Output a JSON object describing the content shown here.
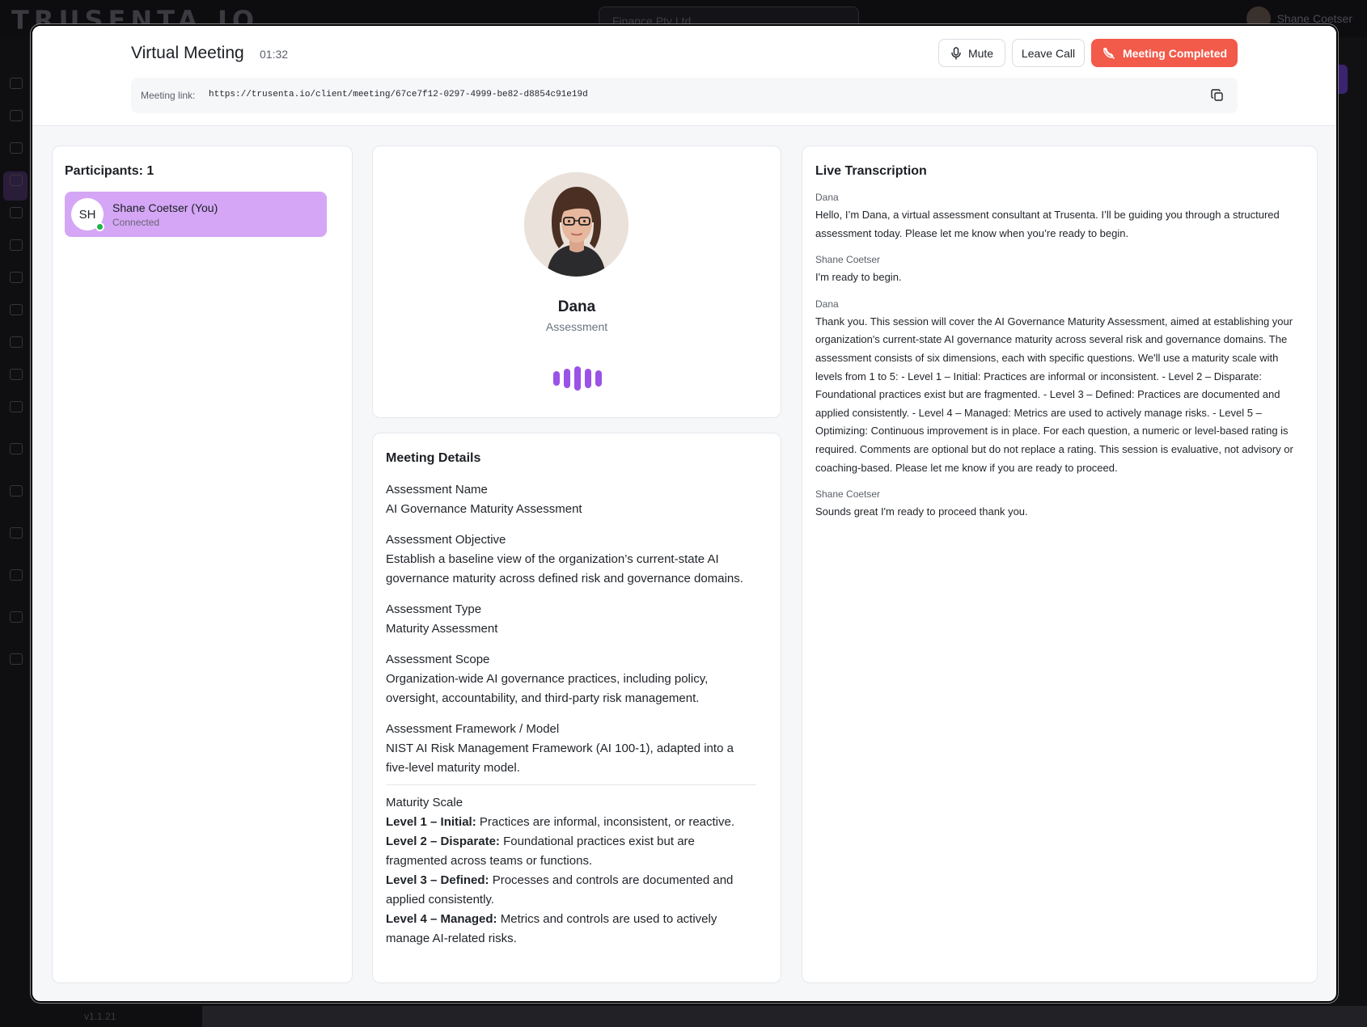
{
  "background": {
    "logo": "TRUSENTA.IO",
    "org_selector": "Finance Pty Ltd",
    "user_name": "Shane Coetser",
    "version": "v1.1.21"
  },
  "meeting": {
    "title": "Virtual Meeting",
    "timer": "01:32",
    "mute_label": "Mute",
    "leave_label": "Leave Call",
    "complete_label": "Meeting Completed",
    "link_label": "Meeting link:",
    "link_url": "https://trusenta.io/client/meeting/67ce7f12-0297-4999-be82-d8854c91e19d"
  },
  "participants": {
    "title": "Participants: 1",
    "items": [
      {
        "initials": "SH",
        "name": "Shane Coetser (You)",
        "status": "Connected"
      }
    ]
  },
  "agent": {
    "name": "Dana",
    "role": "Assessment"
  },
  "details": {
    "title": "Meeting Details",
    "fields": [
      {
        "label": "Assessment Name",
        "value": "AI Governance Maturity Assessment"
      },
      {
        "label": "Assessment Objective",
        "value": "Establish a baseline view of the organization’s current-state AI governance maturity across defined risk and governance domains."
      },
      {
        "label": "Assessment Type",
        "value": "Maturity Assessment"
      },
      {
        "label": "Assessment Scope",
        "value": "Organization-wide AI governance practices, including policy, oversight, accountability, and third-party risk management."
      },
      {
        "label": "Assessment Framework / Model",
        "value": "NIST AI Risk Management Framework (AI 100-1), adapted into a five-level maturity model."
      }
    ],
    "scale_label": "Maturity Scale",
    "levels": [
      {
        "name": "Level 1 – Initial:",
        "text": " Practices are informal, inconsistent, or reactive."
      },
      {
        "name": "Level 2 – Disparate:",
        "text": " Foundational practices exist but are fragmented across teams or functions."
      },
      {
        "name": "Level 3 – Defined:",
        "text": " Processes and controls are documented and applied consistently."
      },
      {
        "name": "Level 4 – Managed:",
        "text": " Metrics and controls are used to actively manage AI-related risks."
      }
    ]
  },
  "transcript": {
    "title": "Live Transcription",
    "messages": [
      {
        "speaker": "Dana",
        "text": "Hello, I’m Dana, a virtual assessment consultant at Trusenta. I’ll be guiding you through a structured assessment today. Please let me know when you’re ready to begin."
      },
      {
        "speaker": "Shane Coetser",
        "text": "I'm ready to begin."
      },
      {
        "speaker": "Dana",
        "text": "Thank you. This session will cover the AI Governance Maturity Assessment, aimed at establishing your organization's current-state AI governance maturity across several risk and governance domains. The assessment consists of six dimensions, each with specific questions. We'll use a maturity scale with levels from 1 to 5: - Level 1 – Initial: Practices are informal or inconsistent. - Level 2 – Disparate: Foundational practices exist but are fragmented. - Level 3 – Defined: Practices are documented and applied consistently. - Level 4 – Managed: Metrics are used to actively manage risks. - Level 5 – Optimizing: Continuous improvement is in place. For each question, a numeric or level-based rating is required. Comments are optional but do not replace a rating. This session is evaluative, not advisory or coaching-based. Please let me know if you are ready to proceed."
      },
      {
        "speaker": "Shane Coetser",
        "text": "Sounds great I'm ready to proceed thank you."
      }
    ]
  },
  "colors": {
    "accent_purple": "#9b52e6",
    "participant_bg": "#d4a6f5",
    "danger": "#f25a4a",
    "online": "#22b14c"
  }
}
